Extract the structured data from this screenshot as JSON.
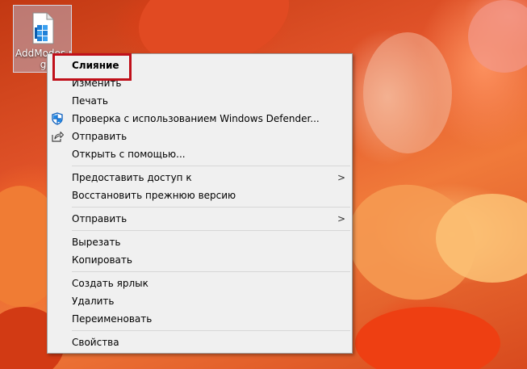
{
  "desktop_icon": {
    "label_line1": "AddModes.r",
    "label_line2": "g",
    "icon": "registry-file-icon"
  },
  "context_menu": {
    "items": [
      {
        "label": "Слияние",
        "bold": true
      },
      {
        "label": "Изменить"
      },
      {
        "label": "Печать"
      },
      {
        "label": "Проверка с использованием Windows Defender...",
        "icon": "defender-shield-icon"
      },
      {
        "label": "Отправить",
        "icon": "share-icon"
      },
      {
        "label": "Открыть с помощью..."
      },
      {
        "label": "Предоставить доступ к",
        "submenu": true
      },
      {
        "label": "Восстановить прежнюю версию"
      },
      {
        "label": "Отправить",
        "submenu": true
      },
      {
        "label": "Вырезать"
      },
      {
        "label": "Копировать"
      },
      {
        "label": "Создать ярлык"
      },
      {
        "label": "Удалить"
      },
      {
        "label": "Переименовать"
      },
      {
        "label": "Свойства"
      }
    ],
    "submenu_glyph": ">"
  },
  "colors": {
    "highlight_border": "#c0101a",
    "menu_background": "#f0f0f0"
  }
}
